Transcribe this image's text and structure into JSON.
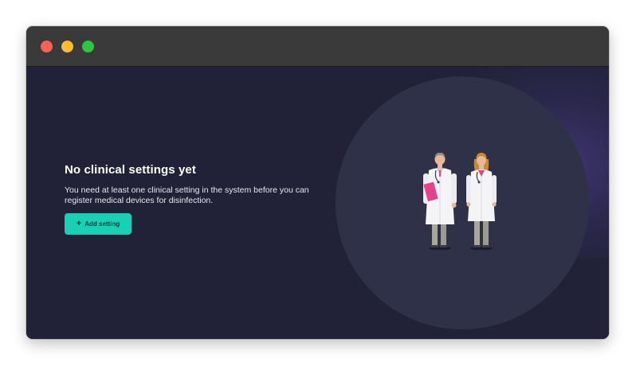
{
  "window": {
    "controls": [
      "close",
      "minimize",
      "maximize"
    ]
  },
  "empty_state": {
    "title": "No clinical settings yet",
    "description": "You need at least one clinical setting in the system before you can register medical devices for disinfection.",
    "add_button_label": "Add setting",
    "add_button_icon": "plus-icon",
    "illustration": "two-doctors-illustration"
  },
  "colors": {
    "background": "#212237",
    "accent": "#17d1b4",
    "circle": "#2f3149",
    "titlebar": "#3a3a3a"
  }
}
